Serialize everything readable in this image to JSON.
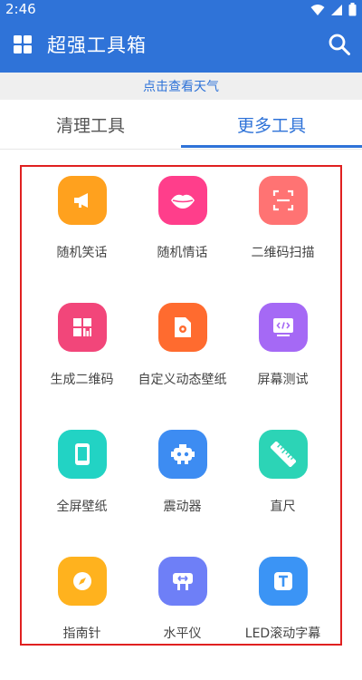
{
  "status_bar": {
    "time": "2:46"
  },
  "appbar": {
    "title": "超强工具箱"
  },
  "weather_bar": {
    "text": "点击查看天气"
  },
  "tabs": [
    {
      "label": "清理工具",
      "active": false
    },
    {
      "label": "更多工具",
      "active": true
    }
  ],
  "colors": {
    "primary": "#2f73d8",
    "highlight_box": "#e02020"
  },
  "tools": [
    {
      "label": "随机笑话",
      "icon": "megaphone-icon",
      "color": "#ffa11e"
    },
    {
      "label": "随机情话",
      "icon": "lips-icon",
      "color": "#ff3e8b"
    },
    {
      "label": "二维码扫描",
      "icon": "scan-icon",
      "color": "#ff7373"
    },
    {
      "label": "生成二维码",
      "icon": "qrcode-icon",
      "color": "#f2467a"
    },
    {
      "label": "自定义动态壁纸",
      "icon": "wallpaper-file-icon",
      "color": "#ff6b2f"
    },
    {
      "label": "屏幕测试",
      "icon": "code-screen-icon",
      "color": "#a569f5"
    },
    {
      "label": "全屏壁纸",
      "icon": "phone-icon",
      "color": "#22d3c4"
    },
    {
      "label": "震动器",
      "icon": "robot-icon",
      "color": "#3d8cf2"
    },
    {
      "label": "直尺",
      "icon": "ruler-icon",
      "color": "#2cd4b6"
    },
    {
      "label": "指南针",
      "icon": "compass-icon",
      "color": "#ffb21e"
    },
    {
      "label": "水平仪",
      "icon": "level-icon",
      "color": "#6e7ff7"
    },
    {
      "label": "LED滚动字幕",
      "icon": "text-t-icon",
      "color": "#3b94f5"
    }
  ]
}
